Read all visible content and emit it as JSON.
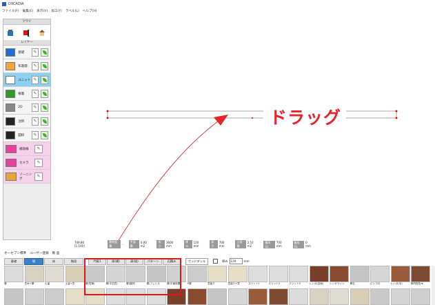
{
  "window": {
    "title": "DXCADIA"
  },
  "menu": [
    "ファイル(F)",
    "編集(E)",
    "表示(V)",
    "加工(Y)",
    "ラベル(L)",
    "ヘルプ(H)"
  ],
  "left_panel": {
    "tools_header": "ツウド",
    "layers_header": "レイヤー",
    "layers": [
      {
        "label": "基礎",
        "color": "#1e6fd0"
      },
      {
        "label": "布基礎",
        "color": "#f0a83c"
      },
      {
        "label": "ユニット",
        "color": "#ffffff"
      },
      {
        "label": "植栽",
        "color": "#2f9a2a"
      },
      {
        "label": "2D",
        "color": "#888888"
      },
      {
        "label": "注釈",
        "color": "#222222"
      },
      {
        "label": "図枠",
        "color": "#222222"
      },
      {
        "label": "補助線",
        "color": "#e5419e"
      },
      {
        "label": "カメラ",
        "color": "#e5419e"
      },
      {
        "label": "ゾーニング",
        "color": "#e5a53c"
      }
    ]
  },
  "annotation": {
    "drag_text": "ドラッグ",
    "arrow_color": "#e8242b"
  },
  "statusbar": {
    "scale": "749.86 [1:100]",
    "f1_label": "敷地面積",
    "f1_value": "-",
    "f2_label": "平面積",
    "f2_value": "0.00 m2",
    "f3_label": "長さ",
    "f3_value": "3600 mm",
    "f4_label": "厚み",
    "f4_value": "120 mm",
    "f5_label": "高さ",
    "f5_value": "700 mm",
    "f6_label": "立面積",
    "f6_value": "2.52 m2",
    "f7_label": "最高GL",
    "f7_value": "700 mm",
    "f8_label": "最低GL",
    "f8_value": "0 mm"
  },
  "source_tabs": [
    "オーセブン標準",
    "ユーザー登録",
    "製 品"
  ],
  "categories": [
    "基礎",
    "塀",
    "床",
    "階段"
  ],
  "categories2": [
    "門扉1",
    "扉(横)",
    "扉(縦)",
    "パターン",
    "石積み"
  ],
  "wood_deck": "ウッドデッキ",
  "thickness": {
    "label": "厚み",
    "value": "120",
    "unit": "mm"
  },
  "catalog_row1": [
    {
      "label": "塀"
    },
    {
      "label": "笠木+塀"
    },
    {
      "label": "土留"
    },
    {
      "label": "土留+笠"
    },
    {
      "label": "塀(笠無)"
    },
    {
      "label": "塀(平石笠)"
    },
    {
      "label": "塀(建材)"
    },
    {
      "label": "塀(フェンス"
    },
    {
      "label": "塀(平面設置"
    },
    {
      "label": "R塀"
    },
    {
      "label": "笠曲り"
    },
    {
      "label": "笠曲り+笠"
    },
    {
      "label": "スリット1"
    },
    {
      "label": "スリット2"
    },
    {
      "label": "スリット3"
    },
    {
      "label": "レンガ(目地)"
    },
    {
      "label": "レンガライン"
    },
    {
      "label": "積石"
    },
    {
      "label": "ピンコロ"
    },
    {
      "label": "レンガ(中)"
    },
    {
      "label": "楕円型笠木"
    }
  ]
}
